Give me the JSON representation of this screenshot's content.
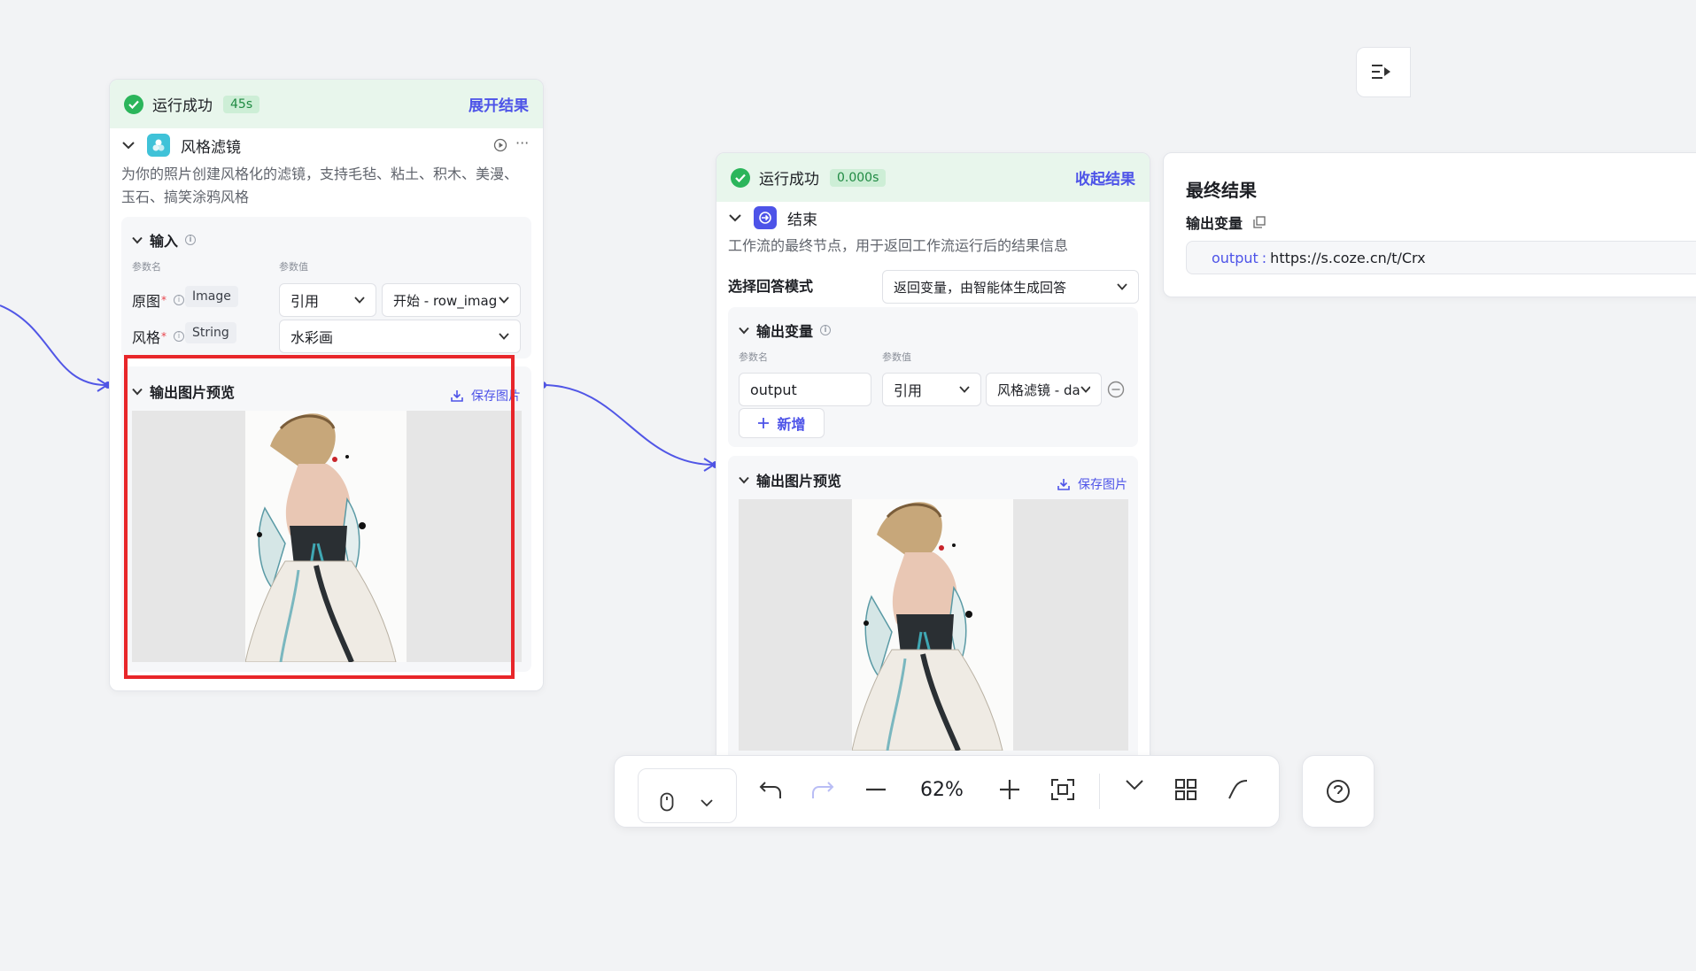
{
  "left_node": {
    "status": "运行成功",
    "time": "45s",
    "toggle": "展开结果",
    "title": "风格滤镜",
    "description": "为你的照片创建风格化的滤镜，支持毛毡、粘土、积木、美漫、玉石、搞笑涂鸦风格",
    "input_section": {
      "title": "输入",
      "col_name": "参数名",
      "col_value": "参数值",
      "rows": [
        {
          "name": "原图",
          "type": "Image",
          "ref": "引用",
          "value": "开始 - row_image"
        },
        {
          "name": "风格",
          "type": "String",
          "value": "水彩画"
        }
      ]
    },
    "preview": {
      "title": "输出图片预览",
      "save": "保存图片"
    }
  },
  "right_node": {
    "status": "运行成功",
    "time": "0.000s",
    "toggle": "收起结果",
    "title": "结束",
    "description": "工作流的最终节点，用于返回工作流运行后的结果信息",
    "mode_label": "选择回答模式",
    "mode_value": "返回变量，由智能体生成回答",
    "output_section": {
      "title": "输出变量",
      "col_name": "参数名",
      "col_value": "参数值",
      "var_name": "output",
      "ref": "引用",
      "value": "风格滤镜 - da",
      "add": "新增"
    },
    "preview": {
      "title": "输出图片预览",
      "save": "保存图片"
    }
  },
  "result_panel": {
    "title": "最终结果",
    "var_label": "输出变量",
    "output_key": "output",
    "output_value": "https://s.coze.cn/t/Crx"
  },
  "toolbar": {
    "zoom": "62%"
  },
  "colors": {
    "accent": "#4d53e8",
    "success": "#2bb55b",
    "highlight": "#e8262a"
  }
}
